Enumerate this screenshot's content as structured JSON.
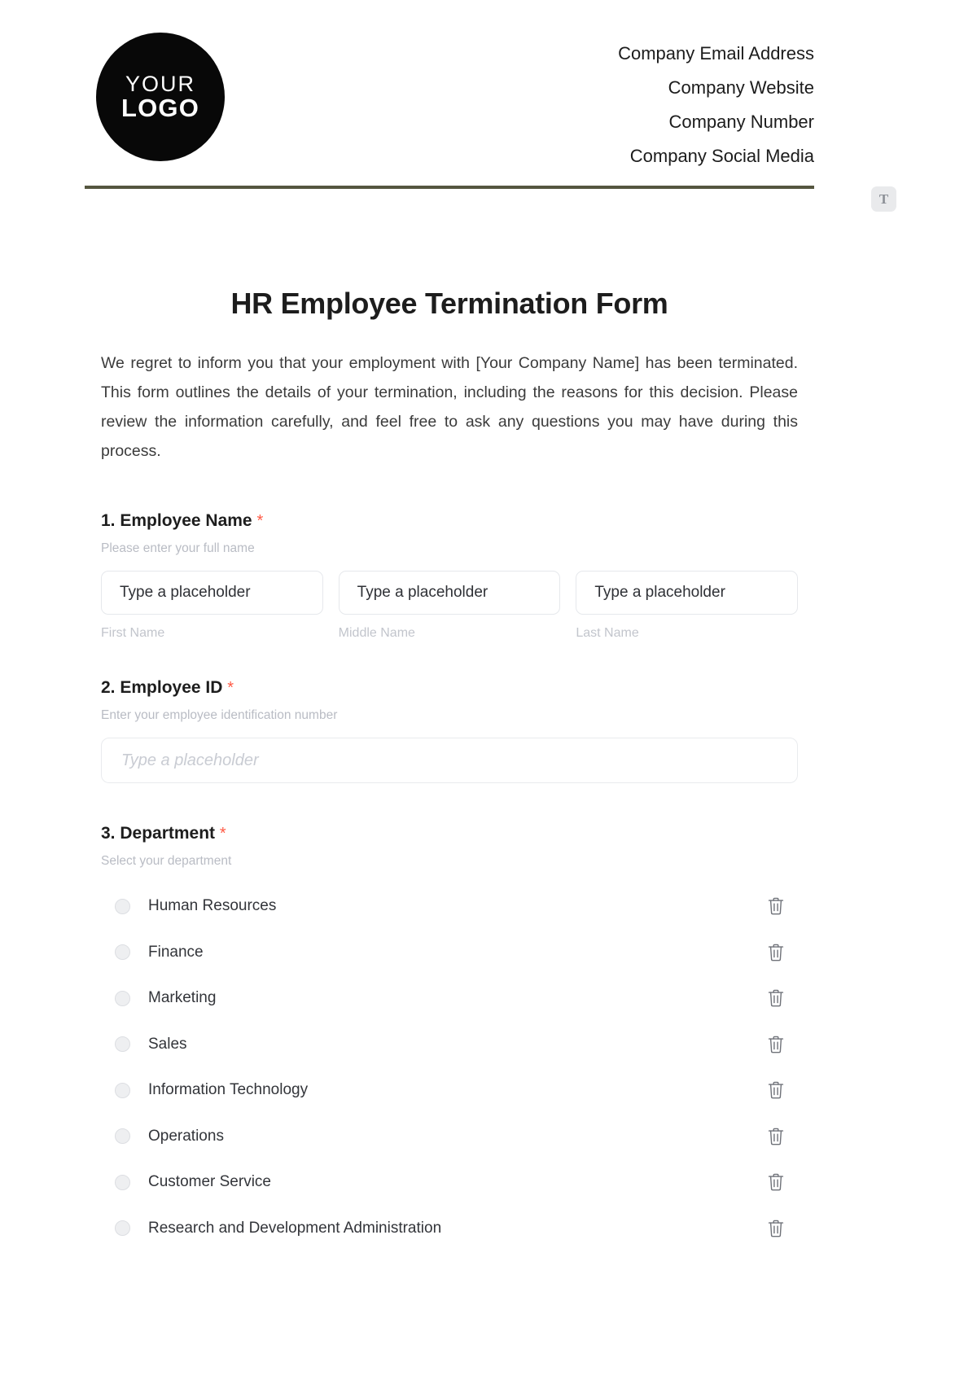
{
  "header": {
    "logo": {
      "line1": "YOUR",
      "line2": "LOGO"
    },
    "contact_lines": [
      "Company Email Address",
      "Company Website",
      "Company Number",
      "Company Social Media"
    ]
  },
  "tool_badge": {
    "label": "T"
  },
  "document": {
    "title": "HR Employee Termination Form",
    "intro": "We regret to inform you that your employment with [Your Company Name] has been terminated. This form outlines the details of your termination, including the reasons for this decision. Please review the information carefully, and feel free to ask any questions you may have during this process."
  },
  "questions": [
    {
      "number": "1.",
      "label": "Employee Name",
      "required_mark": "*",
      "help": "Please enter your full name",
      "fields": [
        {
          "value": "Type a placeholder",
          "sub_label": "First Name"
        },
        {
          "value": "Type a placeholder",
          "sub_label": "Middle Name"
        },
        {
          "value": "Type a placeholder",
          "sub_label": "Last Name"
        }
      ]
    },
    {
      "number": "2.",
      "label": "Employee ID",
      "required_mark": "*",
      "help": "Enter your employee identification number",
      "placeholder": "Type a placeholder"
    },
    {
      "number": "3.",
      "label": "Department",
      "required_mark": "*",
      "help": "Select your department",
      "options": [
        "Human Resources",
        "Finance",
        "Marketing",
        "Sales",
        "Information Technology",
        "Operations",
        "Customer Service",
        "Research and Development Administration"
      ]
    }
  ],
  "colors": {
    "divider": "#55563f",
    "required": "#ff5a45",
    "logo_bg": "#080808",
    "muted": "#b9bcc4"
  }
}
